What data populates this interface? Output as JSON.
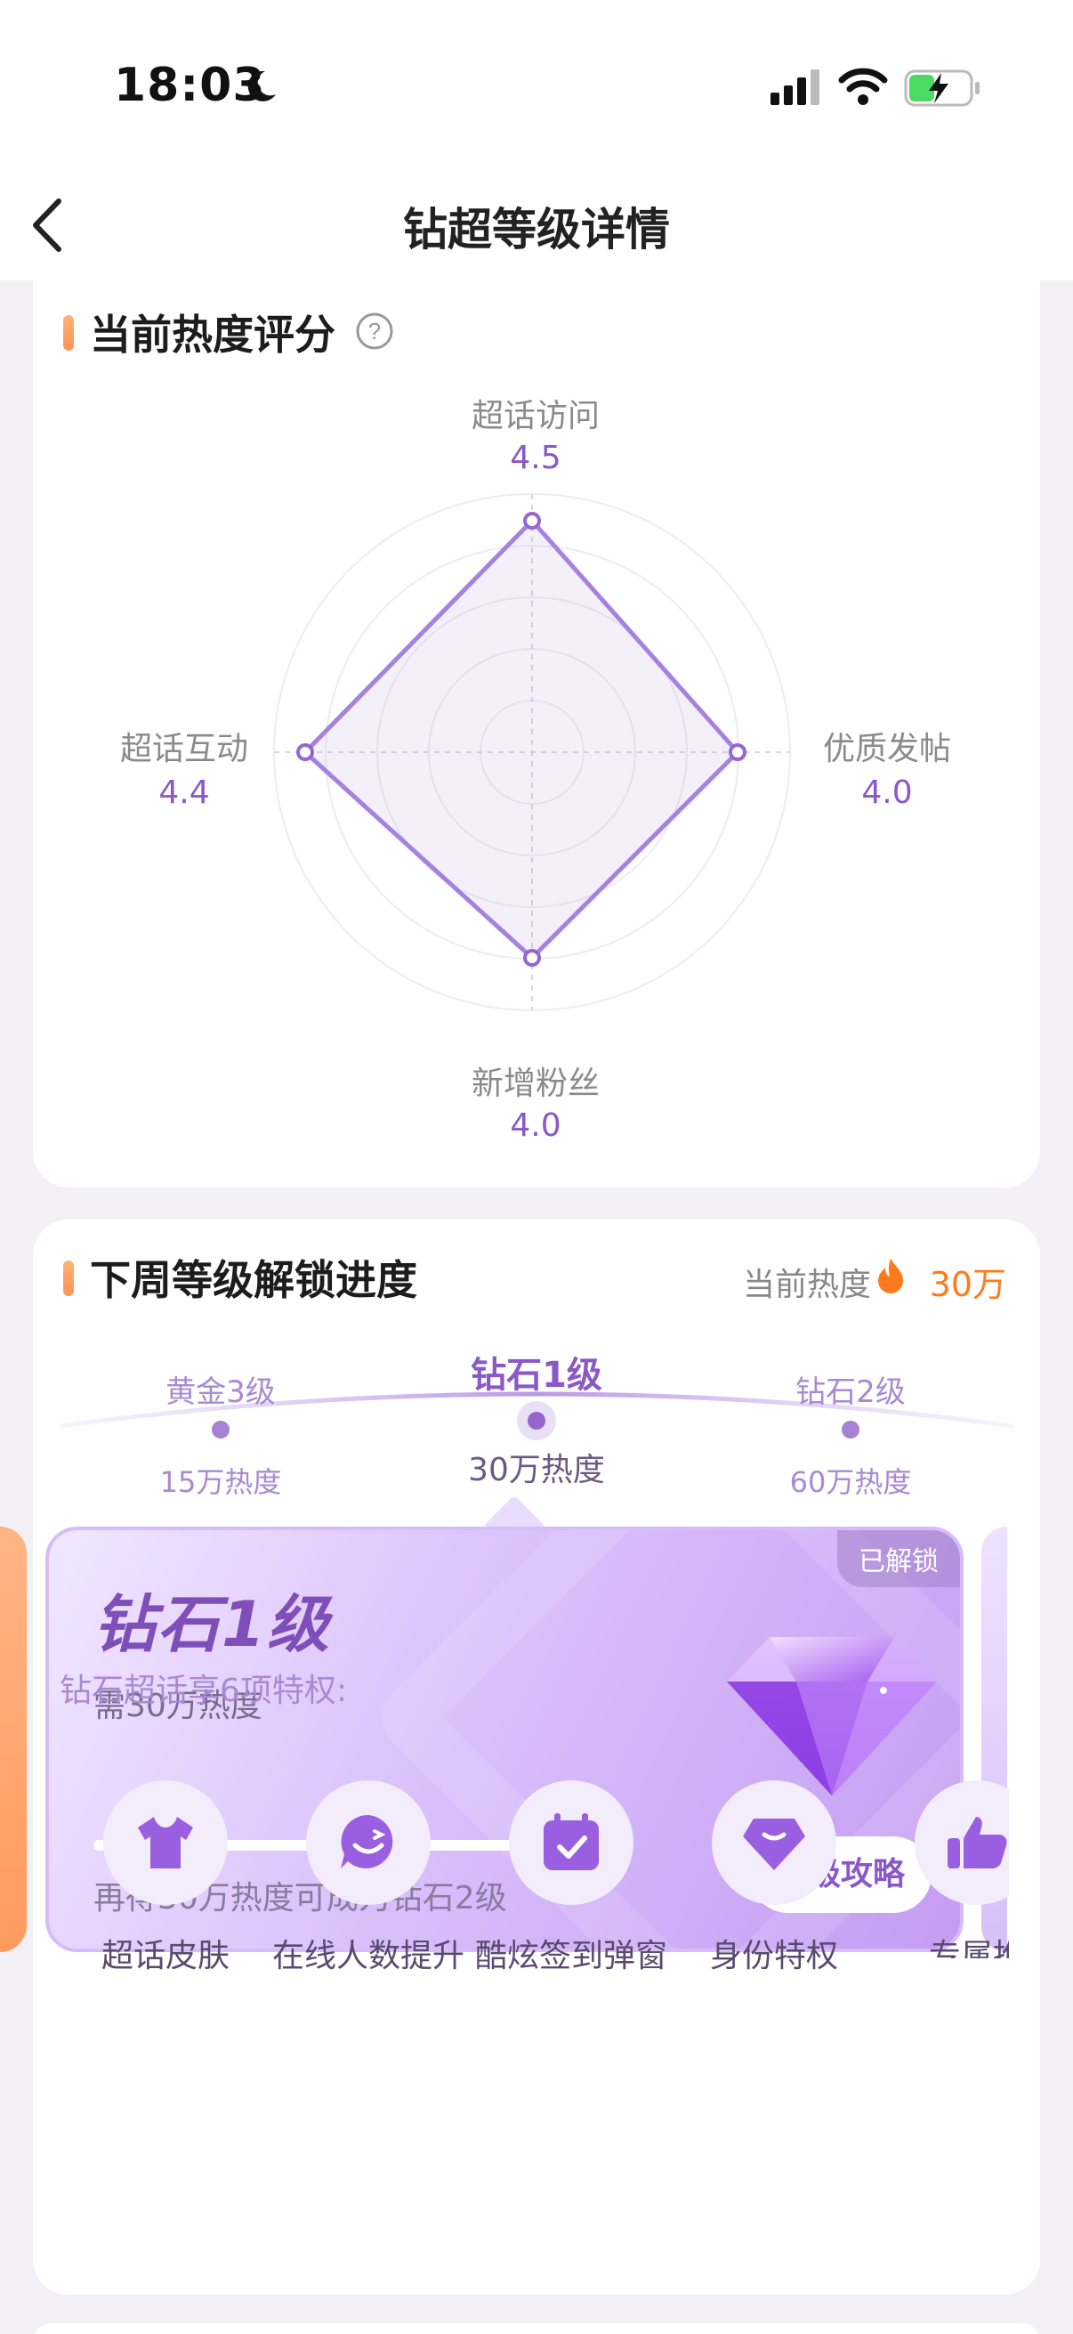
{
  "status_bar": {
    "time": "18:03"
  },
  "nav": {
    "title": "钻超等级详情"
  },
  "heat_score": {
    "title": "当前热度评分",
    "axes": [
      {
        "label": "超话访问",
        "value": "4.5"
      },
      {
        "label": "优质发帖",
        "value": "4.0"
      },
      {
        "label": "新增粉丝",
        "value": "4.0"
      },
      {
        "label": "超话互动",
        "value": "4.4"
      }
    ]
  },
  "progress": {
    "title": "下周等级解锁进度",
    "current_heat_label": "当前热度",
    "current_heat_value": "30万",
    "levels": [
      {
        "name": "黄金3级",
        "heat": "15万热度"
      },
      {
        "name": "钻石1级",
        "heat": "30万热度"
      },
      {
        "name": "钻石2级",
        "heat": "60万热度"
      }
    ],
    "card": {
      "badge": "已解锁",
      "title": "钻石1级",
      "requirement": "需30万热度",
      "progress_fraction": 1.0,
      "tip": "再得30万热度可成为钻石2级",
      "button": "升级攻略"
    },
    "privileges_title": "钻石超话享6项特权:",
    "privileges": [
      {
        "label": "超话皮肤",
        "icon": "tshirt-icon"
      },
      {
        "label": "在线人数提升",
        "icon": "smile-bubble-icon"
      },
      {
        "label": "酷炫签到弹窗",
        "icon": "calendar-check-icon"
      },
      {
        "label": "身份特权",
        "icon": "gem-badge-icon"
      },
      {
        "label": "专属推",
        "icon": "thumbs-up-icon"
      }
    ]
  },
  "colors": {
    "accent": "#8a58c8",
    "heat": "#ff7a1a",
    "section_bar": "#ff9356"
  }
}
